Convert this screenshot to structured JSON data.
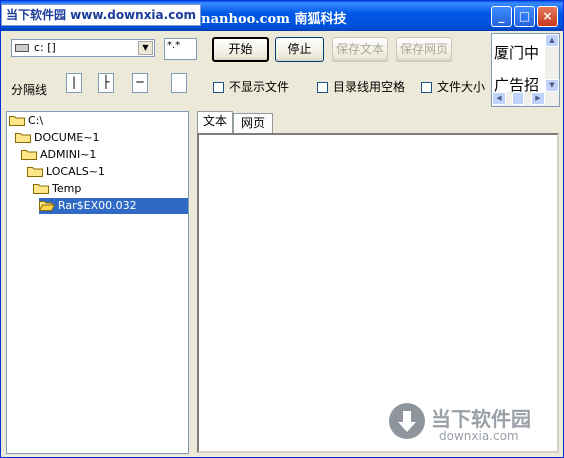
{
  "window": {
    "title": "p://www.nanhoo.com 南狐科技",
    "watermark_top": "当下软件园 www.downxia.com",
    "min_label": "_",
    "max_label": "□",
    "close_label": "×"
  },
  "toolbar": {
    "drive_value": "c: []",
    "filter_value": "*.*",
    "start_label": "开始",
    "stop_label": "停止",
    "save_text_label": "保存文本",
    "save_web_label": "保存网页",
    "separator_label": "分隔线",
    "separators": [
      "|",
      "├",
      "─",
      ""
    ],
    "hide_files_label": "不显示文件",
    "dir_space_label": "目录线用空格",
    "file_size_label": "文件大小",
    "ad_line1": "厦门中",
    "ad_line2": "广告招"
  },
  "tree": {
    "nodes": [
      {
        "label": "C:\\",
        "level": 0
      },
      {
        "label": "DOCUME~1",
        "level": 1
      },
      {
        "label": "ADMINI~1",
        "level": 2
      },
      {
        "label": "LOCALS~1",
        "level": 3
      },
      {
        "label": "Temp",
        "level": 4
      },
      {
        "label": "Rar$EX00.032",
        "level": 5,
        "selected": true
      }
    ]
  },
  "tabs": [
    {
      "label": "文本",
      "active": true
    },
    {
      "label": "网页",
      "active": false
    }
  ],
  "watermark_bottom": {
    "name": "当下软件园",
    "url": "downxia.com"
  },
  "colors": {
    "accent": "#0058e6",
    "selection": "#316ac5"
  }
}
